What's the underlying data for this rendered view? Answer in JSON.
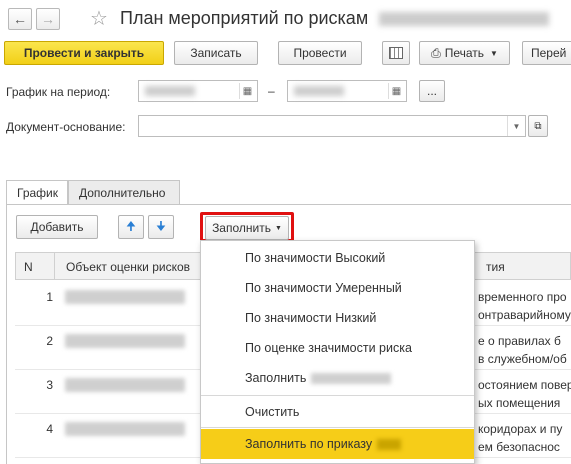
{
  "window": {
    "back_icon": "arrow-left-icon",
    "forward_icon": "arrow-right-icon",
    "favorite_icon": "star-icon",
    "title": "План мероприятий по рискам"
  },
  "toolbar": {
    "post_close": "Провести и закрыть",
    "save": "Записать",
    "post": "Провести",
    "print": "Печать",
    "goto": "Перей"
  },
  "form": {
    "period_label": "График на период:",
    "dash": "–",
    "ellipsis": "...",
    "basis_label": "Документ-основание:"
  },
  "tabs": [
    "График",
    "Дополнительно"
  ],
  "table_toolbar": {
    "add": "Добавить",
    "fill": "Заполнить"
  },
  "table": {
    "columns": [
      "N",
      "Объект оценки рисков",
      "тия"
    ],
    "rows": [
      {
        "n": "1",
        "right": [
          "временного про",
          "онтраварийному"
        ]
      },
      {
        "n": "2",
        "right": [
          "е о правилах б",
          "в служебном/об"
        ]
      },
      {
        "n": "3",
        "right": [
          "остоянием повер",
          "ых помещения"
        ]
      },
      {
        "n": "4",
        "right": [
          "коридорах и пу",
          "ем безопаснос"
        ]
      }
    ]
  },
  "fill_menu": {
    "items": [
      "По значимости Высокий",
      "По значимости Умеренный",
      "По значимости Низкий",
      "По оценке значимости риска",
      "Заполнить",
      "Очистить",
      "Заполнить по приказу"
    ]
  },
  "colors": {
    "primary_yellow": "#f1cf17",
    "highlight": "#f6cd18",
    "red_frame": "#e01010"
  }
}
